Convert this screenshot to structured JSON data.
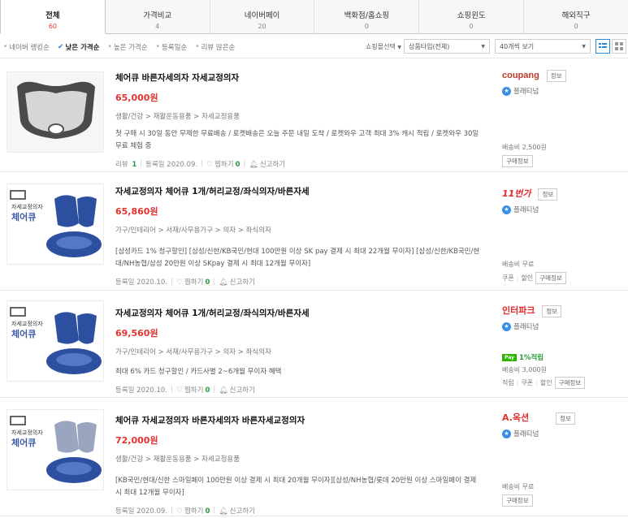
{
  "tabs": [
    {
      "label": "전체",
      "count": "60"
    },
    {
      "label": "가격비교",
      "count": "4"
    },
    {
      "label": "네이버페이",
      "count": "20"
    },
    {
      "label": "백화점/홈쇼핑",
      "count": "0"
    },
    {
      "label": "쇼핑윈도",
      "count": "0"
    },
    {
      "label": "해외직구",
      "count": "0"
    }
  ],
  "sort": {
    "options": [
      "네이버 랭킹순",
      "낮은 가격순",
      "높은 가격순",
      "등록일순",
      "리뷰 많은순"
    ],
    "filter_label": "쇼핑몰선택",
    "product_type": "상품타입(전체)",
    "per_page": "40개씩 보기"
  },
  "products": [
    {
      "title": "체어큐 바른자세의자 자세교정의자",
      "price": "65,000원",
      "category": "생활/건강 > 재활운동용품 > 자세교정용품",
      "desc": "첫 구매 시 30일 동안 무제한 무료배송 / 로켓배송은 오늘 주문 내일 도착 / 로켓와우 고객 최대 3% 캐시 적립 / 로켓와우 30일 무료 체험 중",
      "review_label": "리뷰",
      "review_count": "1",
      "reg_date": "등록일 2020.09.",
      "wish_label": "찜하기",
      "wish_count": "0",
      "report_label": "신고하기",
      "seller_logo": "coupang",
      "seller_info": "정보",
      "grade": "플래티넘",
      "shipping": "배송비 2,500원",
      "buy_info": "구매정보"
    },
    {
      "title": "자세교정의자 체어큐 1개/허리교정/좌식의자/바른자세",
      "price": "65,860원",
      "category": "가구/인테리어 > 서재/사무용가구 > 의자 > 좌식의자",
      "desc": "[삼성카드 1% 청구할인] [삼성/신한/KB국민/현대 100만원 이상 SK pay 결제 시 최대 22개월 무이자] [삼성/신한/KB국민/현대/NH농협/삼성 20만원 이상 SKpay 결제 시 최대 12개월 무이자]",
      "reg_date": "등록일 2020.10.",
      "wish_label": "찜하기",
      "wish_count": "0",
      "report_label": "신고하기",
      "seller_logo": "11번가",
      "seller_info": "정보",
      "grade": "플래티넘",
      "shipping": "배송비 무료",
      "link1": "쿠폰",
      "link2": "할인",
      "buy_info": "구매정보"
    },
    {
      "title": "자세교정의자 체어큐 1개/허리교정/좌식의자/바른자세",
      "price": "69,560원",
      "category": "가구/인테리어 > 서재/사무용가구 > 의자 > 좌식의자",
      "desc": "최대 6% 카드 청구할인 / 카드사별 2~6개월 무이자 혜택",
      "reg_date": "등록일 2020.10.",
      "wish_label": "찜하기",
      "wish_count": "0",
      "report_label": "신고하기",
      "seller_logo": "인터파크",
      "seller_info": "정보",
      "grade": "플래티넘",
      "npay_badge": "Pay",
      "point": "1%적립",
      "shipping": "배송비 3,000원",
      "link0": "적립",
      "link1": "쿠폰",
      "link2": "할인",
      "buy_info": "구매정보"
    },
    {
      "title": "체어큐 자세교정의자 바른자세의자 바른자세교정의자",
      "price": "72,000원",
      "category": "생활/건강 > 재활운동용품 > 자세교정용품",
      "desc": "[KB국민/현대/신한 스마일페이 100만원 이상 결제 시 최대 20개월 무이자][삼성/NH농협/롯데 20만원 이상 스마일페이 결제 시 최대 12개월 무이자]",
      "reg_date": "등록일 2020.09.",
      "wish_label": "찜하기",
      "wish_count": "0",
      "report_label": "신고하기",
      "seller_logo": "A.옥션",
      "seller_info": "정보",
      "grade": "플래티넘",
      "shipping": "배송비 무료",
      "buy_info": "구매정보"
    }
  ],
  "thumb": {
    "brand_text": "자세교정의자",
    "brand_name": "체어큐"
  },
  "colors": {
    "price": "#e0342f",
    "accent": "#2b87d8",
    "coupang": "#c0392b",
    "st11": "#e8262c",
    "interpark": "#e8262c",
    "auction": "#e0342f"
  }
}
